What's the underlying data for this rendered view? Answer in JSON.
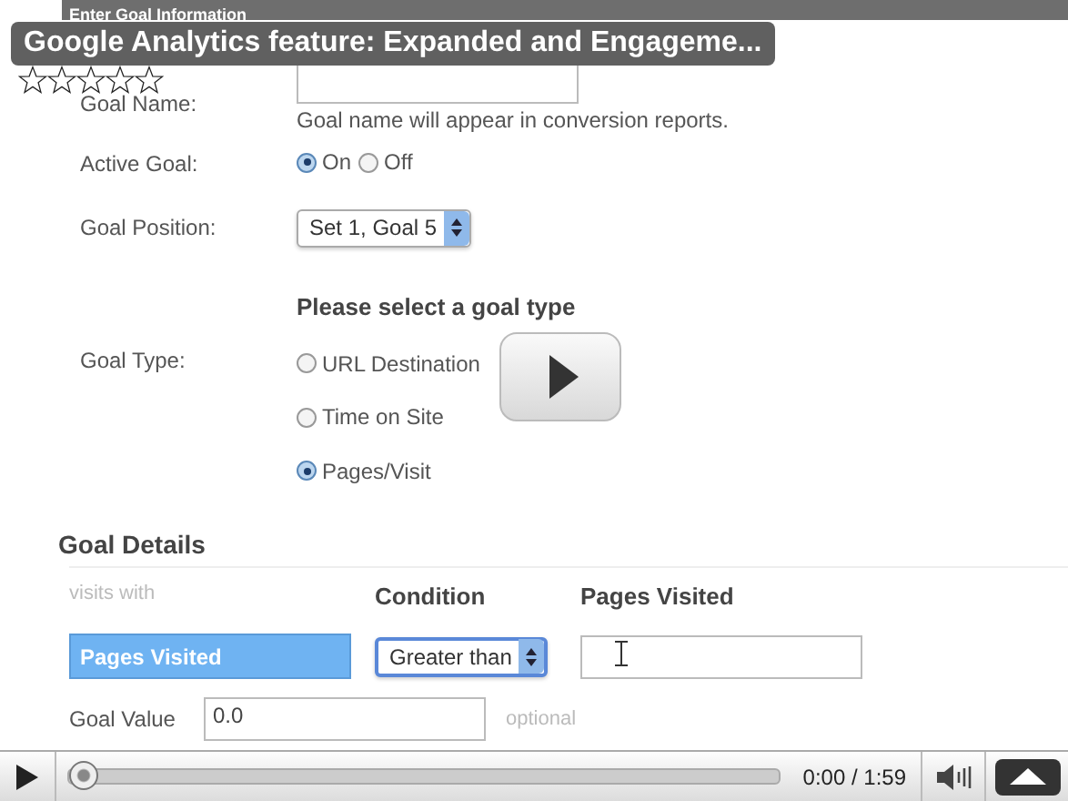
{
  "video": {
    "title": "Google Analytics feature: Expanded and Engageme...",
    "stars": 0
  },
  "frame": {
    "header": "Enter Goal Information",
    "goal_name": {
      "label": "Goal Name:",
      "hint": "Goal name will appear in conversion reports."
    },
    "active_goal": {
      "label": "Active Goal:",
      "options": [
        {
          "label": "On",
          "selected": true
        },
        {
          "label": "Off",
          "selected": false
        }
      ]
    },
    "goal_position": {
      "label": "Goal Position:",
      "value": "Set 1, Goal 5"
    },
    "goal_type": {
      "prompt": "Please select a goal type",
      "label": "Goal Type:",
      "options": [
        {
          "label": "URL Destination",
          "selected": false
        },
        {
          "label": "Time on Site",
          "selected": false
        },
        {
          "label": "Pages/Visit",
          "selected": true
        }
      ]
    },
    "goal_details": {
      "heading": "Goal Details",
      "columns": [
        "visits with",
        "Condition",
        "Pages Visited"
      ],
      "metric": "Pages Visited",
      "condition": "Greater than",
      "value_label": "Goal Value",
      "value": "0.0",
      "note": "optional"
    }
  },
  "controls": {
    "time": "0:00 / 1:59",
    "level": 0
  }
}
